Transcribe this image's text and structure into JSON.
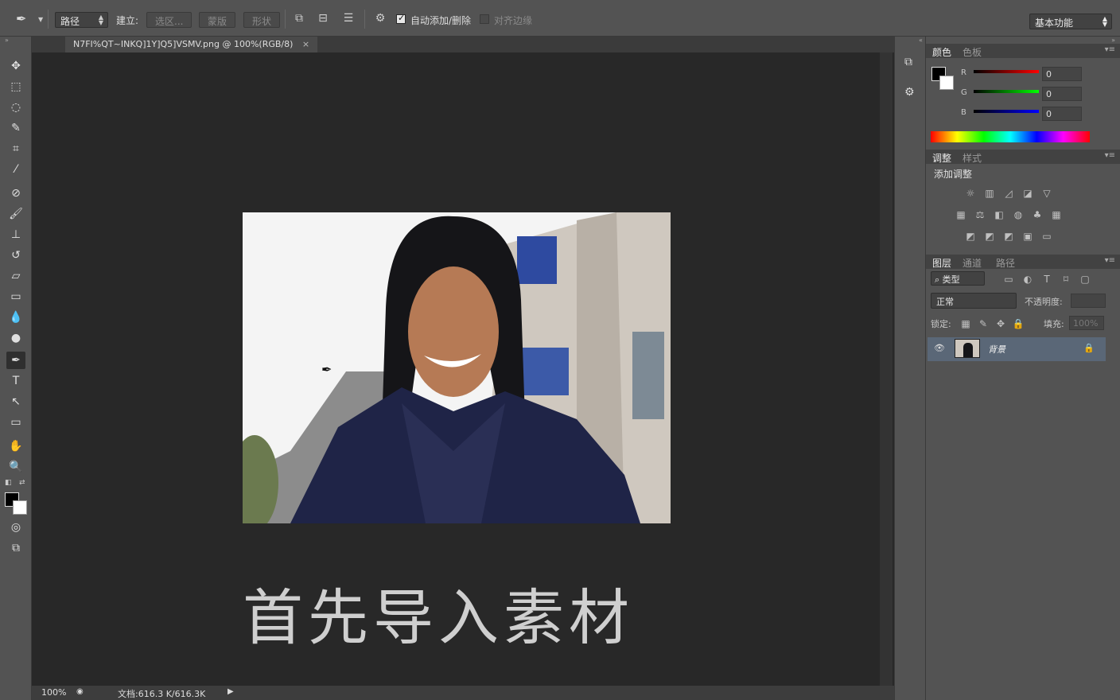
{
  "options_bar": {
    "mode_select": "路径",
    "build_label": "建立:",
    "btn_selection": "选区...",
    "btn_mask": "蒙版",
    "btn_shape": "形状",
    "auto_add_delete": "自动添加/删除",
    "align_edges": "对齐边缘",
    "workspace": "基本功能"
  },
  "document": {
    "tab_title": "N7FI%QT~INKQ]1Y]Q5]VSMV.png @ 100%(RGB/8)",
    "tab_close": "×",
    "caption": "首先导入素材",
    "zoom": "100%",
    "doc_size": "文档:616.3 K/616.3K"
  },
  "color_panel": {
    "tabs": [
      "颜色",
      "色板"
    ],
    "r_label": "R",
    "g_label": "G",
    "b_label": "B",
    "r_value": "0",
    "g_value": "0",
    "b_value": "0",
    "fg_color": "#000000",
    "bg_color": "#ffffff"
  },
  "adjust_panel": {
    "tabs": [
      "调整",
      "样式"
    ],
    "heading": "添加调整"
  },
  "layers_panel": {
    "tabs": [
      "图层",
      "通道",
      "路径"
    ],
    "filter_kind": "类型",
    "blend_mode": "正常",
    "opacity_label": "不透明度:",
    "lock_label": "锁定:",
    "fill_label": "填充:",
    "fill_value": "100%",
    "layer_name": "背景"
  }
}
